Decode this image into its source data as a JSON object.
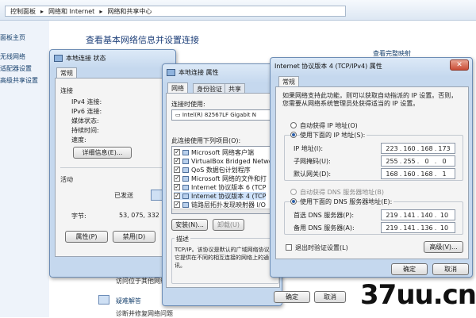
{
  "control_panel": {
    "breadcrumb": [
      "控制面板",
      "网络和 Internet",
      "网络和共享中心"
    ],
    "nav": [
      "面板主页",
      "无线网络",
      "适配器设置",
      "高级共享设置"
    ],
    "heading": "查看基本网络信息并设置连接",
    "full_map_link": "查看完整映射",
    "access_text": "访问位于其他网络",
    "troubleshoot_link": "疑难解答",
    "bottom_text": "诊断并修复网络问题"
  },
  "status_window": {
    "title": "本地连接 状态",
    "tab": "常规",
    "section_connection": "连接",
    "rows": [
      {
        "label": "IPv4 连接:",
        "value": ""
      },
      {
        "label": "IPv6 连接:",
        "value": ""
      },
      {
        "label": "媒体状态:",
        "value": ""
      },
      {
        "label": "持续时间:",
        "value": ""
      },
      {
        "label": "速度:",
        "value": ""
      }
    ],
    "details_button": "详细信息(E)...",
    "section_activity": "活动",
    "sent_label": "已发送",
    "bytes_label": "字节:",
    "bytes_sent": "53, 075, 332",
    "properties_button": "属性(P)",
    "disable_button": "禁用(D)"
  },
  "properties_window": {
    "title": "本地连接 属性",
    "tabs": [
      "网络",
      "身份验证",
      "共享"
    ],
    "connect_using_label": "连接时使用:",
    "adapter": "Intel(R) 82567LF Gigabit N",
    "items_label": "此连接使用下列项目(O):",
    "items": [
      {
        "checked": "✓",
        "label": "Microsoft 网络客户端"
      },
      {
        "checked": "✓",
        "label": "VirtualBox Bridged Netwo"
      },
      {
        "checked": "✓",
        "label": "QoS 数据包计划程序"
      },
      {
        "checked": "✓",
        "label": "Microsoft 网络的文件和打"
      },
      {
        "checked": "✓",
        "label": "Internet 协议版本 6 (TCP"
      },
      {
        "checked": "✓",
        "label": "Internet 协议版本 4 (TCP"
      },
      {
        "checked": "✓",
        "label": "链路层拓扑发现映射器 I/O"
      }
    ],
    "install_button": "安装(N)...",
    "uninstall_button": "卸载(U)",
    "description_label": "描述",
    "description_text": "TCP/IP。该协议是默认的广域网络协议，它提供在不同的相互连接的网络上的通讯。",
    "ok_button": "确定",
    "cancel_button": "取消"
  },
  "ipv4_window": {
    "title": "Internet 协议版本 4 (TCP/IPv4) 属性",
    "tab": "常规",
    "intro": "如果网络支持此功能，则可以获取自动指派的 IP 设置。否则，您需要从网络系统管理员处获得适当的 IP 设置。",
    "auto_ip": "自动获得 IP 地址(O)",
    "manual_ip": "使用下面的 IP 地址(S):",
    "ip_label": "IP 地址(I):",
    "ip": [
      "223",
      "160",
      "168",
      "173"
    ],
    "mask_label": "子网掩码(U):",
    "mask": [
      "255",
      "255",
      "0",
      "0"
    ],
    "gateway_label": "默认网关(D):",
    "gateway": [
      "168",
      "160",
      "168",
      "1"
    ],
    "auto_dns": "自动获得 DNS 服务器地址(B)",
    "manual_dns": "使用下面的 DNS 服务器地址(E):",
    "dns1_label": "首选 DNS 服务器(P):",
    "dns1": [
      "219",
      "141",
      "140",
      "10"
    ],
    "dns2_label": "备用 DNS 服务器(A):",
    "dns2": [
      "219",
      "141",
      "136",
      "10"
    ],
    "validate_label": "退出时验证设置(L)",
    "advanced_button": "高级(V)...",
    "ok_button": "确定",
    "cancel_button": "取消"
  },
  "watermark": "37uu.cn"
}
